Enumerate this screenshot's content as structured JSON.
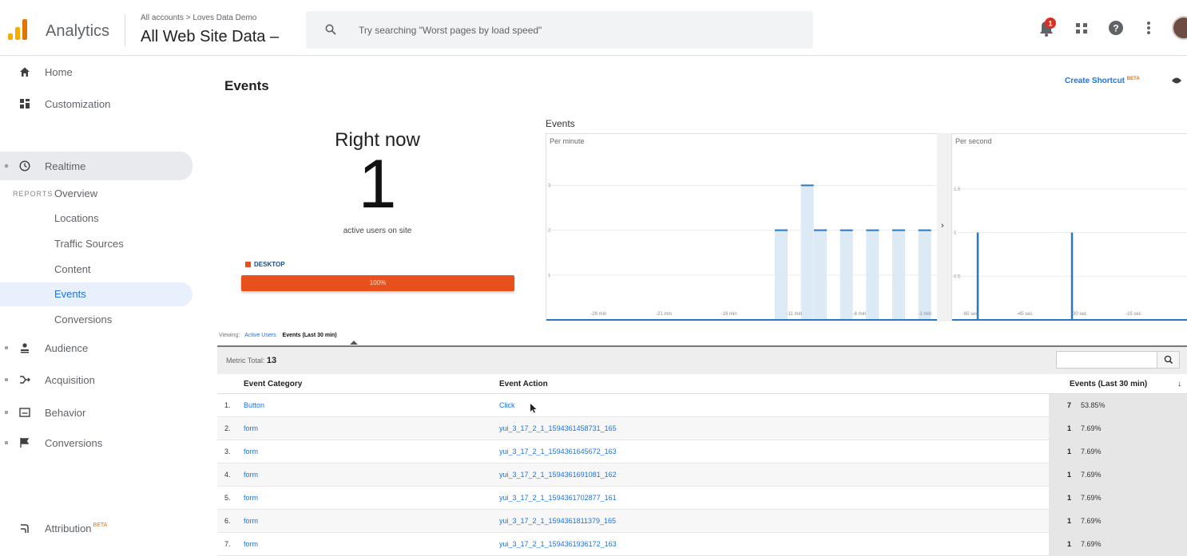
{
  "header": {
    "app_name": "Analytics",
    "breadcrumb": "All accounts > Loves Data Demo",
    "property": "All Web Site Data –",
    "search_placeholder": "Try searching \"Worst pages by load speed\"",
    "notification_count": "1"
  },
  "sidebar": {
    "home": "Home",
    "customization": "Customization",
    "reports_label": "REPORTS",
    "realtime": "Realtime",
    "realtime_items": [
      "Overview",
      "Locations",
      "Traffic Sources",
      "Content",
      "Events",
      "Conversions"
    ],
    "audience": "Audience",
    "acquisition": "Acquisition",
    "behavior": "Behavior",
    "conversions": "Conversions",
    "attribution": "Attribution",
    "attribution_badge": "BETA"
  },
  "page": {
    "title": "Events",
    "create_shortcut": "Create Shortcut",
    "shortcut_badge": "BETA"
  },
  "realtime": {
    "title": "Right now",
    "active_users": "1",
    "subtitle": "active users on site",
    "device_label": "DESKTOP",
    "device_percent": "100%",
    "device_share": 1.0
  },
  "chart_data": [
    {
      "type": "bar",
      "title": "Events",
      "subtitle": "Per minute",
      "x_tick_labels": [
        "-26 min",
        "-21 min",
        "-16 min",
        "-11 min",
        "-6 min",
        "-1 min"
      ],
      "y_tick_labels": [
        "1",
        "2",
        "3"
      ],
      "ylim": [
        0,
        3.7
      ],
      "bar_minutes_ago": [
        12,
        10,
        9,
        7,
        5,
        3,
        1
      ],
      "values": [
        2,
        3,
        2,
        2,
        2,
        2,
        2
      ]
    },
    {
      "type": "bar",
      "subtitle": "Per second",
      "x_tick_labels": [
        "-60 sec",
        "-45 sec",
        "-30 sec",
        "-15 sec"
      ],
      "y_tick_labels": [
        "0.5",
        "1",
        "1.5"
      ],
      "ylim": [
        0,
        1.9
      ],
      "bar_seconds_ago": [
        58,
        32
      ],
      "values": [
        1,
        1
      ]
    }
  ],
  "table": {
    "viewing_label": "Viewing:",
    "viewing_active": "Active Users",
    "viewing_current": "Events (Last 30 min)",
    "metric_label": "Metric Total:",
    "metric_total": "13",
    "col_category": "Event Category",
    "col_action": "Event Action",
    "col_events": "Events (Last 30 min)",
    "sort_icon": "↓",
    "rows": [
      {
        "n": "1.",
        "category": "Button",
        "action": "Click",
        "events": "7",
        "pct": "53.85%"
      },
      {
        "n": "2.",
        "category": "form",
        "action": "yui_3_17_2_1_1594361458731_165",
        "events": "1",
        "pct": "7.69%"
      },
      {
        "n": "3.",
        "category": "form",
        "action": "yui_3_17_2_1_1594361645672_163",
        "events": "1",
        "pct": "7.69%"
      },
      {
        "n": "4.",
        "category": "form",
        "action": "yui_3_17_2_1_1594361691081_162",
        "events": "1",
        "pct": "7.69%"
      },
      {
        "n": "5.",
        "category": "form",
        "action": "yui_3_17_2_1_1594361702877_161",
        "events": "1",
        "pct": "7.69%"
      },
      {
        "n": "6.",
        "category": "form",
        "action": "yui_3_17_2_1_1594361811379_165",
        "events": "1",
        "pct": "7.69%"
      },
      {
        "n": "7.",
        "category": "form",
        "action": "yui_3_17_2_1_1594361936172_163",
        "events": "1",
        "pct": "7.69%"
      }
    ]
  },
  "colors": {
    "accent": "#1a73e8",
    "device_bar": "#e8501c",
    "chart_bar": "#dbeaf5",
    "chart_line": "#2b78c2"
  }
}
